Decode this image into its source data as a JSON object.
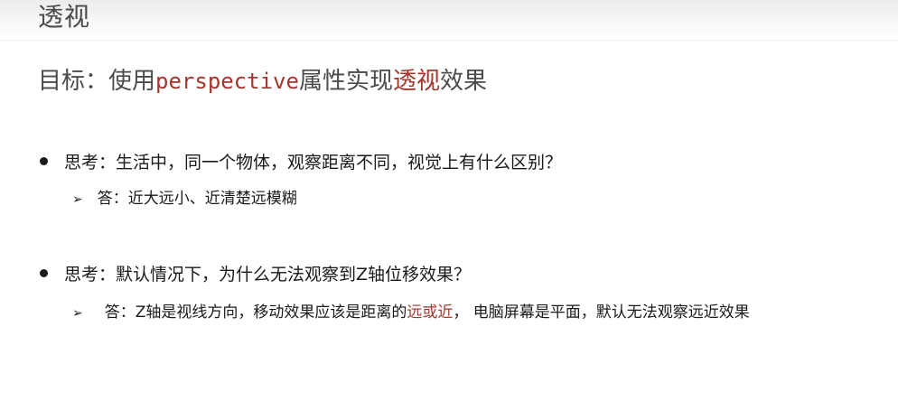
{
  "title": "透视",
  "goal": {
    "prefix": "目标：使用",
    "code": "perspective",
    "middle": "属性实现",
    "highlight": "透视",
    "suffix": "效果"
  },
  "sections": [
    {
      "question": "思考：生活中，同一个物体，观察距离不同，视觉上有什么区别？",
      "answer_prefix": "答：近大远小、近清楚远模糊"
    },
    {
      "question": "思考：默认情况下，为什么无法观察到Z轴位移效果？",
      "answer_prefix": "答：Z轴是视线方向，移动效果应该是距离的",
      "answer_highlight": "远或近",
      "answer_suffix": "， 电脑屏幕是平面，默认无法观察远近效果"
    }
  ],
  "bullet_arrow": "➢",
  "colors": {
    "accent": "#a4362b",
    "title": "#4a4a4a",
    "text": "#1a1a1a"
  }
}
